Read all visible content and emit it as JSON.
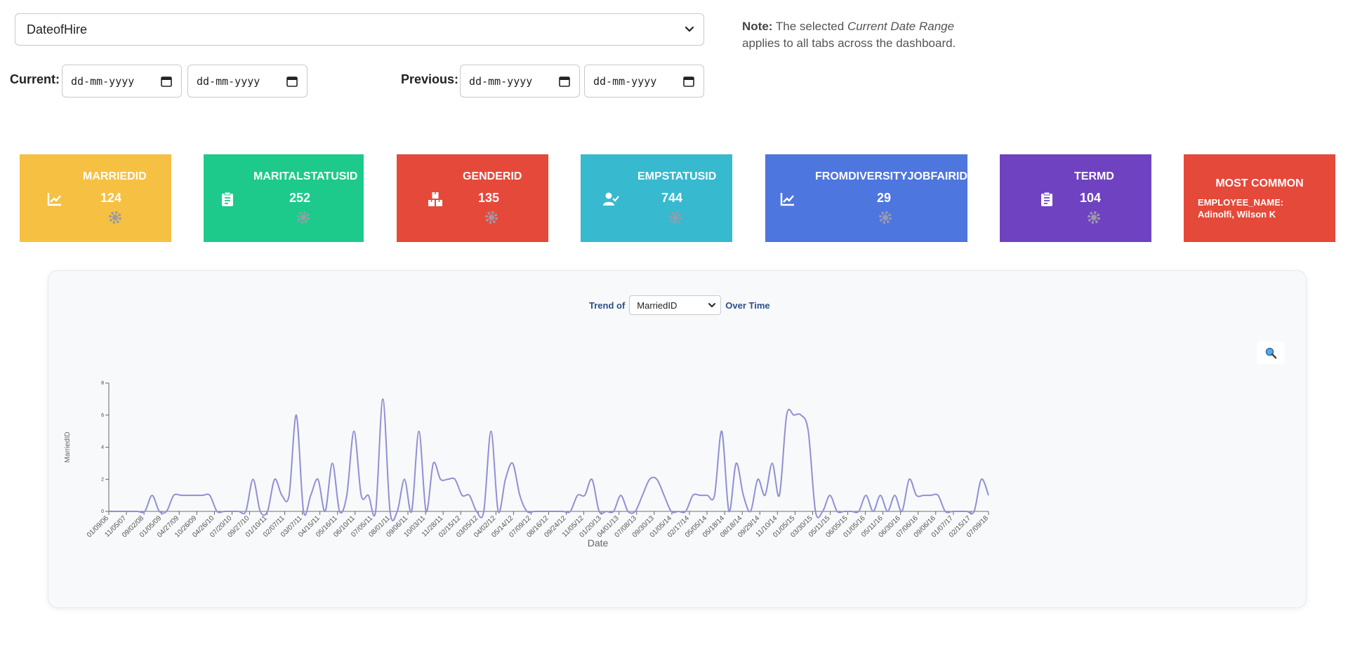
{
  "filters": {
    "column_select": {
      "value": "DateofHire"
    },
    "current_label": "Current:",
    "previous_label": "Previous:",
    "date_placeholder": "dd-mm-yyyy"
  },
  "note": {
    "bold": "Note:",
    "text1": " The selected ",
    "italic": "Current Date Range",
    "text2": " applies to all tabs across the dashboard."
  },
  "cards": [
    {
      "title": "MARRIEDID",
      "value": "124",
      "color": "#f6c042",
      "icon": "chart-line-icon"
    },
    {
      "title": "MARITALSTATUSID",
      "value": "252",
      "color": "#1dca8b",
      "icon": "clipboard-icon"
    },
    {
      "title": "GENDERID",
      "value": "135",
      "color": "#e5493a",
      "icon": "boxes-icon"
    },
    {
      "title": "EMPSTATUSID",
      "value": "744",
      "color": "#37b9cf",
      "icon": "user-check-icon"
    },
    {
      "title": "FROMDIVERSITYJOBFAIRID",
      "value": "29",
      "color": "#4e76df",
      "icon": "chart-line-icon"
    },
    {
      "title": "TERMD",
      "value": "104",
      "color": "#6f42c1",
      "icon": "clipboard-icon"
    }
  ],
  "most_common": {
    "title": "MOST COMMON",
    "label": "EMPLOYEE_NAME:",
    "value": "Adinolfi, Wilson K",
    "color": "#e5493a"
  },
  "trend": {
    "prefix": "Trend of",
    "selected": "MarriedID",
    "suffix": "Over Time",
    "zoom_icon": "magnifier-icon"
  },
  "chart_data": {
    "type": "line",
    "xlabel": "Date",
    "ylabel": "MarriedID",
    "ylim": [
      0,
      8
    ],
    "yticks": [
      "0",
      "2",
      "4",
      "6",
      "8"
    ],
    "line_color": "#8f8fd6",
    "x_ticks": [
      "01/09/06",
      "11/05/07",
      "09/02/08",
      "01/05/09",
      "04/27/09",
      "10/26/09",
      "04/26/10",
      "07/20/10",
      "09/27/10",
      "01/10/11",
      "02/07/11",
      "03/07/11",
      "04/15/11",
      "05/16/11",
      "06/10/11",
      "07/05/11",
      "08/01/11",
      "09/06/11",
      "10/03/11",
      "11/28/11",
      "02/15/12",
      "03/05/12",
      "04/02/12",
      "05/14/12",
      "07/09/12",
      "08/16/12",
      "09/24/12",
      "11/05/12",
      "01/20/13",
      "04/01/13",
      "07/08/13",
      "09/30/13",
      "01/05/14",
      "02/17/14",
      "05/05/14",
      "05/18/14",
      "08/18/14",
      "09/29/14",
      "11/10/14",
      "01/05/15",
      "03/30/15",
      "05/11/15",
      "06/05/15",
      "01/05/16",
      "05/11/16",
      "06/30/16",
      "07/06/16",
      "09/06/16",
      "01/07/17",
      "02/15/17",
      "07/09/18"
    ],
    "values": [
      0,
      0,
      0,
      0,
      0,
      0,
      1,
      0,
      0,
      1,
      1,
      1,
      1,
      1,
      1,
      0,
      0,
      0,
      0,
      0,
      2,
      0,
      0,
      2,
      1,
      1,
      6,
      0,
      1,
      2,
      0,
      3,
      0,
      1,
      5,
      1,
      1,
      0,
      7,
      0,
      0,
      2,
      0,
      5,
      0,
      3,
      2,
      2,
      2,
      1,
      1,
      0,
      0,
      5,
      0,
      2,
      3,
      1,
      0,
      0,
      0,
      0,
      0,
      0,
      0,
      1,
      1,
      2,
      0,
      0,
      0,
      1,
      0,
      0,
      1,
      2,
      2,
      1,
      0,
      0,
      0,
      1,
      1,
      1,
      1,
      5,
      0,
      3,
      1,
      0,
      2,
      1,
      3,
      1,
      6,
      6,
      6,
      5,
      0,
      0,
      1,
      0,
      0,
      0,
      0,
      1,
      0,
      1,
      0,
      1,
      0,
      2,
      1,
      1,
      1,
      1,
      0,
      0,
      0,
      0,
      0,
      2,
      1
    ]
  }
}
